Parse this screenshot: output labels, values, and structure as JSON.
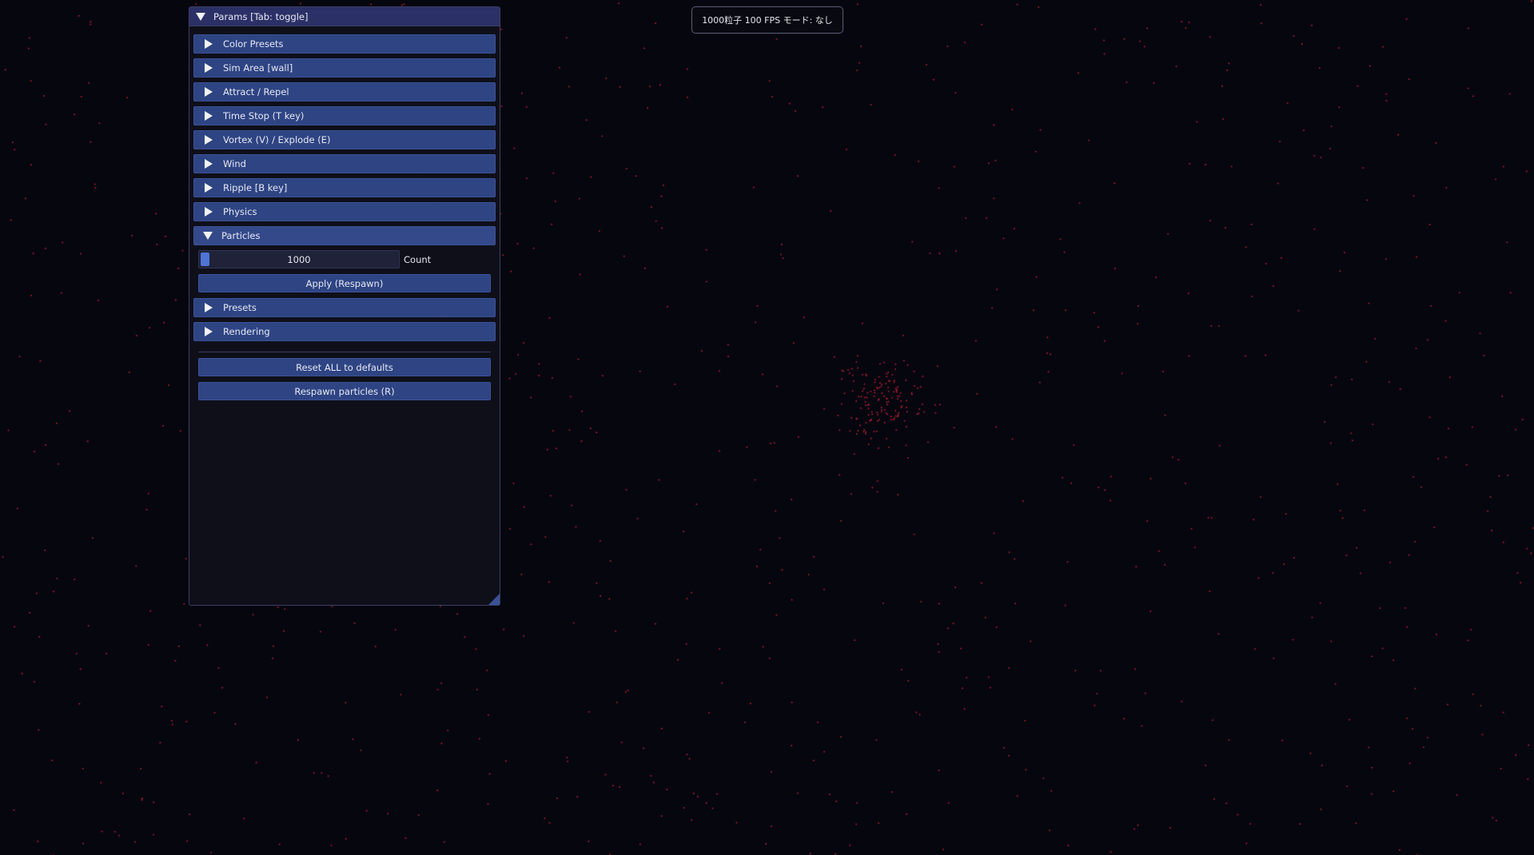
{
  "hud": {
    "text": "1000粒子  100 FPS  モード: なし"
  },
  "panel": {
    "title": "Params  [Tab: toggle]",
    "sections": [
      {
        "label": "Color Presets",
        "open": false
      },
      {
        "label": "Sim Area  [wall]",
        "open": false
      },
      {
        "label": "Attract / Repel",
        "open": false
      },
      {
        "label": "Time Stop (T key)",
        "open": false
      },
      {
        "label": "Vortex (V) / Explode (E)",
        "open": false
      },
      {
        "label": "Wind",
        "open": false
      },
      {
        "label": "Ripple  [B key]",
        "open": false
      },
      {
        "label": "Physics",
        "open": false
      },
      {
        "label": "Particles",
        "open": true
      },
      {
        "label": "Presets",
        "open": false
      },
      {
        "label": "Rendering",
        "open": false
      }
    ],
    "particles": {
      "count_value": "1000",
      "count_label": "Count",
      "apply_label": "Apply (Respawn)"
    },
    "reset_label": "Reset ALL to defaults",
    "respawn_label": "Respawn particles (R)"
  },
  "colors": {
    "background": "#06060f",
    "particle": "#c4213a",
    "header": "#2e4483",
    "title_bar": "#2b3067",
    "slider_grab": "#4f74d8"
  },
  "icons": {
    "collapsed": "triangle-right-icon",
    "expanded": "triangle-down-icon"
  }
}
